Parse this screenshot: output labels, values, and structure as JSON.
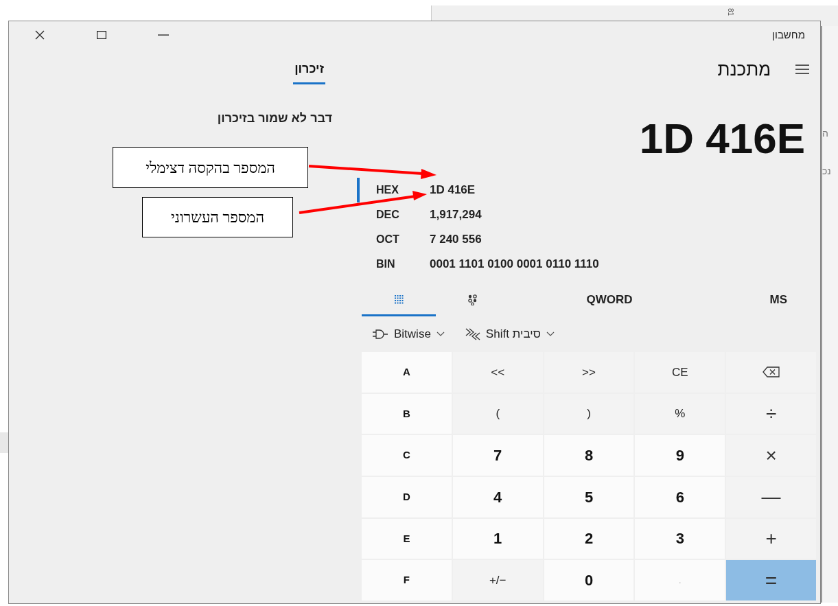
{
  "background": {
    "top_tab": "81",
    "side_texts": [
      "ה",
      "נכ"
    ]
  },
  "window": {
    "title": "מחשבון"
  },
  "header": {
    "mode": "מתכנת"
  },
  "memory": {
    "tabs": [
      {
        "label": "זיכרון",
        "selected": true
      }
    ],
    "empty_message": "דבר לא שמור בזיכרון"
  },
  "display": {
    "value": "1D 416E"
  },
  "radix": [
    {
      "label": "HEX",
      "value": "1D 416E",
      "selected": true
    },
    {
      "label": "DEC",
      "value": "1,917,294",
      "selected": false
    },
    {
      "label": "OCT",
      "value": "7 240 556",
      "selected": false
    },
    {
      "label": "BIN",
      "value": "0001 1101 0100 0001 0110 1110",
      "selected": false
    }
  ],
  "mode_tabs": [
    {
      "kind": "text",
      "label": "MS",
      "selected": false
    },
    {
      "kind": "text",
      "label": "QWORD",
      "selected": false
    },
    {
      "kind": "bits",
      "selected": false
    },
    {
      "kind": "keypad",
      "selected": true
    }
  ],
  "dropdowns": [
    {
      "kind": "shift",
      "label": "סיבית Shift"
    },
    {
      "kind": "bitwise",
      "label": "Bitwise"
    }
  ],
  "keys": [
    [
      {
        "kind": "backspace"
      },
      {
        "kind": "op",
        "label": "CE"
      },
      {
        "kind": "op",
        "label": ">>"
      },
      {
        "kind": "op",
        "label": "<<"
      },
      {
        "kind": "letter",
        "label": "A"
      }
    ],
    [
      {
        "kind": "symbol",
        "label": "÷"
      },
      {
        "kind": "op",
        "label": "%"
      },
      {
        "kind": "op",
        "label": ")"
      },
      {
        "kind": "op",
        "label": "("
      },
      {
        "kind": "letter",
        "label": "B"
      }
    ],
    [
      {
        "kind": "symbol",
        "label": "×"
      },
      {
        "kind": "digit",
        "label": "9"
      },
      {
        "kind": "digit",
        "label": "8"
      },
      {
        "kind": "digit",
        "label": "7"
      },
      {
        "kind": "letter",
        "label": "C"
      }
    ],
    [
      {
        "kind": "symbol",
        "label": "—"
      },
      {
        "kind": "digit",
        "label": "6"
      },
      {
        "kind": "digit",
        "label": "5"
      },
      {
        "kind": "digit",
        "label": "4"
      },
      {
        "kind": "letter",
        "label": "D"
      }
    ],
    [
      {
        "kind": "symbol",
        "label": "+"
      },
      {
        "kind": "digit",
        "label": "3"
      },
      {
        "kind": "digit",
        "label": "2"
      },
      {
        "kind": "digit",
        "label": "1"
      },
      {
        "kind": "letter",
        "label": "E"
      }
    ],
    [
      {
        "kind": "equals",
        "label": "="
      },
      {
        "kind": "disabled",
        "label": "."
      },
      {
        "kind": "digit",
        "label": "0"
      },
      {
        "kind": "op",
        "label": "+/−"
      },
      {
        "kind": "letter",
        "label": "F"
      }
    ]
  ],
  "annotations": [
    {
      "text": "המספר בהקסה דצימלי"
    },
    {
      "text": "המספר העשרוני"
    }
  ]
}
